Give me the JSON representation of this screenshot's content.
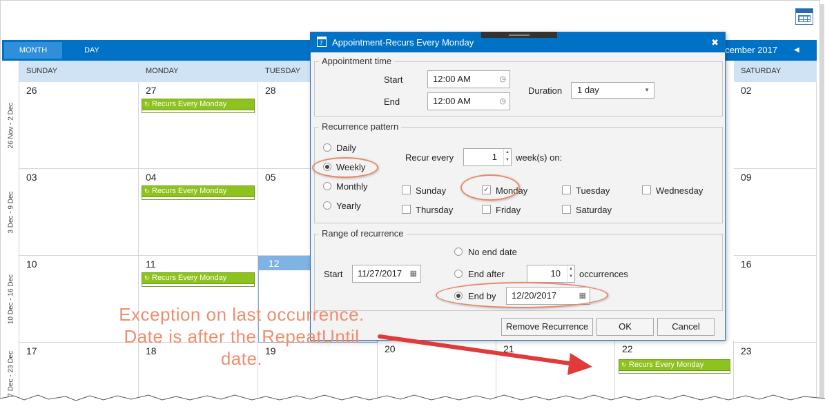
{
  "toolbar": {
    "view_month": "MONTH",
    "view_day": "DAY",
    "range_title": "ecember 2017",
    "prev": "◀"
  },
  "day_headers": [
    "SUNDAY",
    "MONDAY",
    "TUESDAY",
    "SATURDAY"
  ],
  "weeks": [
    "26 Nov - 2 Dec",
    "3 Dec - 9 Dec",
    "10 Dec - 16 Dec",
    "17 Dec - 23 Dec"
  ],
  "dates": {
    "w1": [
      "26",
      "27",
      "28",
      "02"
    ],
    "w2": [
      "03",
      "04",
      "05",
      "09"
    ],
    "w3": [
      "10",
      "11",
      "12",
      "16"
    ],
    "w4": [
      "17",
      "18",
      "19",
      "20",
      "21",
      "22",
      "23"
    ]
  },
  "appointment_label": "Recurs Every Monday",
  "colors": {
    "accent": "#0072c6",
    "appointment": "#8dc21f",
    "annotation": "#ee8e6e",
    "today": "#7eb3e4"
  },
  "dialog": {
    "title": "Appointment-Recurs Every Monday",
    "appointment_time": {
      "legend": "Appointment time",
      "start_label": "Start",
      "start_value": "12:00 AM",
      "end_label": "End",
      "end_value": "12:00 AM",
      "duration_label": "Duration",
      "duration_value": "1 day"
    },
    "recurrence_pattern": {
      "legend": "Recurrence pattern",
      "options": [
        "Daily",
        "Weekly",
        "Monthly",
        "Yearly"
      ],
      "selected": "Weekly",
      "recur_every_label": "Recur every",
      "recur_every_value": "1",
      "weeks_on_label": "week(s) on:",
      "days": [
        "Sunday",
        "Monday",
        "Tuesday",
        "Wednesday",
        "Thursday",
        "Friday",
        "Saturday"
      ],
      "checked_day": "Monday"
    },
    "range": {
      "legend": "Range of recurrence",
      "start_label": "Start",
      "start_value": "11/27/2017",
      "no_end_label": "No end date",
      "end_after_label": "End after",
      "end_after_value": "10",
      "occurrences_label": "occurrences",
      "end_by_label": "End by",
      "end_by_value": "12/20/2017",
      "selected": "End by"
    },
    "buttons": {
      "remove": "Remove Recurrence",
      "ok": "OK",
      "cancel": "Cancel"
    }
  },
  "annotation": {
    "line1": "Exception on last occurrence.",
    "line2": "Date is after the RepeatUntil",
    "line3": "date."
  }
}
